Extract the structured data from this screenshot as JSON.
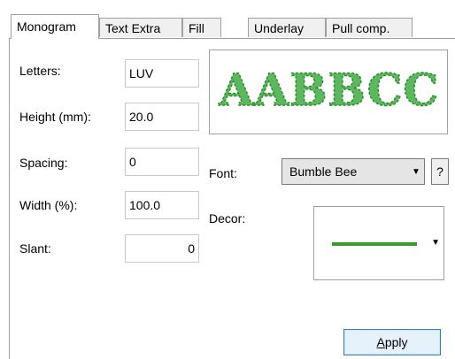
{
  "tabs": [
    {
      "label": "Monogram",
      "active": true
    },
    {
      "label": "Text Extra",
      "active": false
    },
    {
      "label": "Fill",
      "active": false
    },
    {
      "label": "Underlay",
      "active": false
    },
    {
      "label": "Pull comp.",
      "active": false
    }
  ],
  "form": {
    "letters_label": "Letters:",
    "letters_value": "LUV",
    "height_label": "Height (mm):",
    "height_value": "20.0",
    "spacing_label": "Spacing:",
    "spacing_value": "0",
    "width_label": "Width (%):",
    "width_value": "100.0",
    "slant_label": "Slant:",
    "slant_value": "0"
  },
  "preview": {
    "text": "AABBCC",
    "color": "#5cb85c"
  },
  "font": {
    "label": "Font:",
    "value": "Bumble Bee",
    "help": "?"
  },
  "decor": {
    "label": "Decor:",
    "line_color": "#3a9a27"
  },
  "apply_label": "Apply"
}
